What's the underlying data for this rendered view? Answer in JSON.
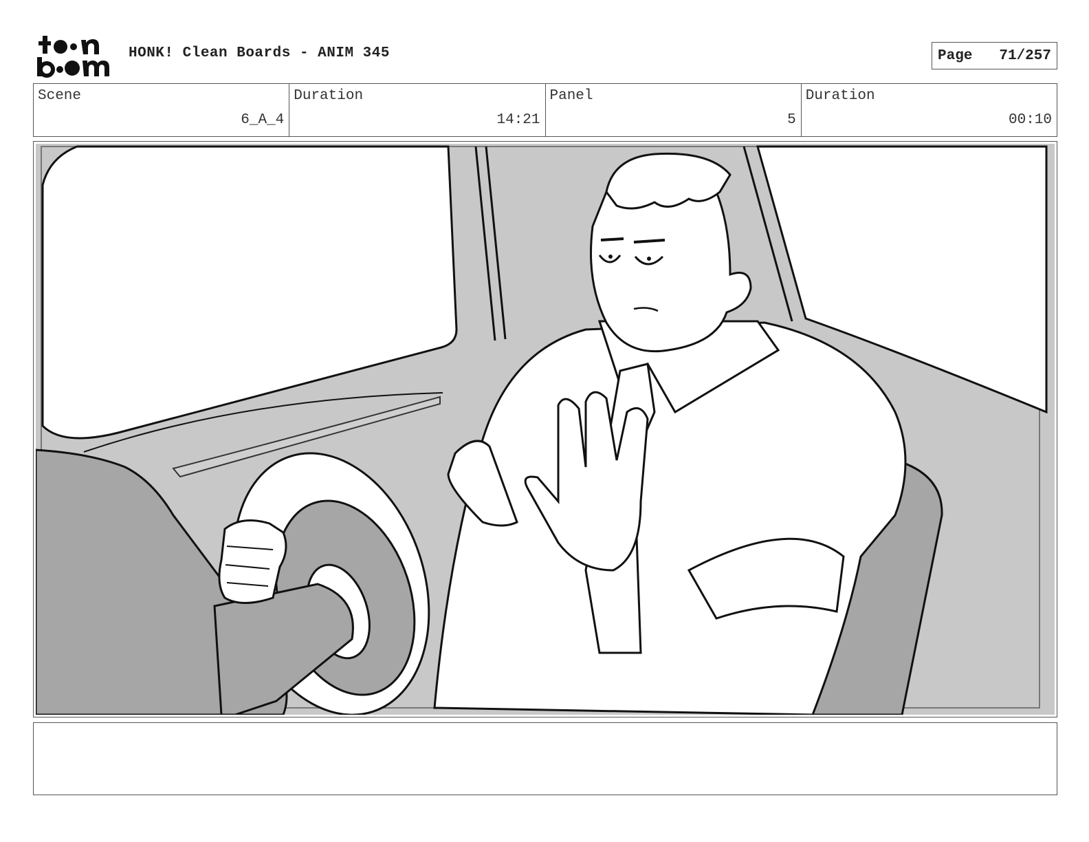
{
  "header": {
    "logo_text": "toon boom",
    "title": "HONK! Clean Boards - ANIM 345",
    "page_label": "Page",
    "page_value": "71/257"
  },
  "info": {
    "scene_label": "Scene",
    "scene_value": "6_A_4",
    "scene_duration_label": "Duration",
    "scene_duration_value": "14:21",
    "panel_label": "Panel",
    "panel_value": "5",
    "panel_duration_label": "Duration",
    "panel_duration_value": "00:10"
  },
  "panel_image": {
    "icon": "storyboard-drawing-driver-in-car"
  },
  "notes": {
    "text": ""
  }
}
